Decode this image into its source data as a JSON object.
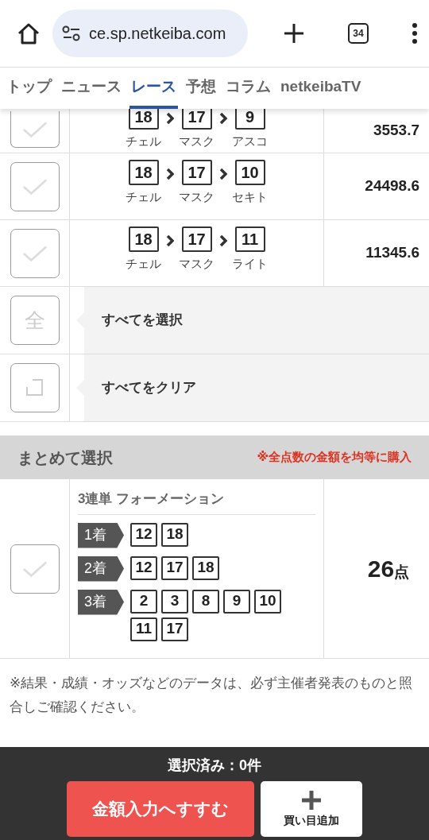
{
  "browser": {
    "url": "ce.sp.netkeiba.com",
    "tab_count": "34"
  },
  "nav_tabs": [
    {
      "label": "トップ",
      "selected": false
    },
    {
      "label": "ニュース",
      "selected": false
    },
    {
      "label": "レース",
      "selected": true
    },
    {
      "label": "予想",
      "selected": false
    },
    {
      "label": "コラム",
      "selected": false
    },
    {
      "label": "netkeibaTV",
      "selected": false
    }
  ],
  "bets": [
    {
      "checked": false,
      "horses": [
        {
          "number": "18",
          "name": "チェル"
        },
        {
          "number": "17",
          "name": "マスク"
        },
        {
          "number": "9",
          "name": "アスコ"
        }
      ],
      "odds": "3553.7"
    },
    {
      "checked": false,
      "horses": [
        {
          "number": "18",
          "name": "チェル"
        },
        {
          "number": "17",
          "name": "マスク"
        },
        {
          "number": "10",
          "name": "セキト"
        }
      ],
      "odds": "24498.6"
    },
    {
      "checked": false,
      "horses": [
        {
          "number": "18",
          "name": "チェル"
        },
        {
          "number": "17",
          "name": "マスク"
        },
        {
          "number": "11",
          "name": "ライト"
        }
      ],
      "odds": "11345.6"
    }
  ],
  "bulk_actions": [
    {
      "kind": "select_all",
      "checked": false,
      "icon_text": "全",
      "label": "すべてを選択"
    },
    {
      "kind": "clear",
      "checked": false,
      "label": "すべてをクリア"
    }
  ],
  "summary": {
    "title": "まとめて選択",
    "notice": "※全点数の金額を均等に購入"
  },
  "formation": {
    "checked": false,
    "title": "3連単 フォーメーション",
    "places": [
      {
        "label": "1着",
        "numbers": [
          "12",
          "18"
        ]
      },
      {
        "label": "2着",
        "numbers": [
          "12",
          "17",
          "18"
        ]
      },
      {
        "label": "3着",
        "numbers": [
          "2",
          "3",
          "8",
          "9",
          "10",
          "11",
          "17"
        ]
      }
    ],
    "count": "26",
    "count_unit": "点"
  },
  "note": "※結果・成績・オッズなどのデータは、必ず主催者発表のものと照合しご確認ください。",
  "footer": {
    "selected_count": "選択済み：0件",
    "primary_button": "金額入力へすすむ",
    "add_button": "買い目追加"
  }
}
